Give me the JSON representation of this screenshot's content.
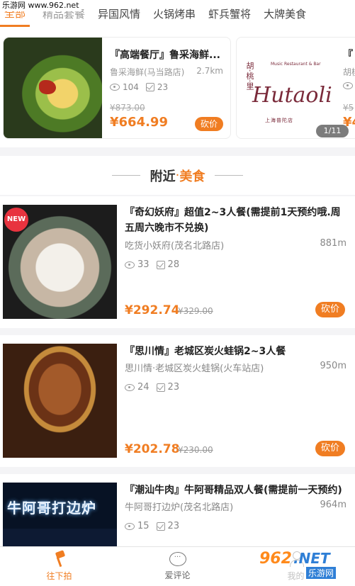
{
  "watermark_top": "乐游网 www.962.net",
  "tabs": [
    "全部",
    "精品套餐",
    "异国风情",
    "火锅烤串",
    "虾兵蟹将",
    "大牌美食"
  ],
  "carousel": {
    "pager": "1/11",
    "cards": [
      {
        "title": "『高端餐厅』鲁采海鲜...",
        "shop": "鲁采海鲜(马当路店)",
        "distance": "2.7km",
        "views": "104",
        "checks": "23",
        "old_price": "¥873.00",
        "price": "¥664.99",
        "bargain": "砍价"
      },
      {
        "title": "『",
        "shop": "胡桃",
        "logo_cn": "胡·桃·里",
        "logo_en": "Hutaoli",
        "logo_small": "Music Restaurant & Bar",
        "logo_addr": "上海普陀店",
        "views": "",
        "checks": "",
        "old_price": "¥5",
        "price": "¥4"
      }
    ]
  },
  "section": {
    "left": "附近",
    "dot": "·",
    "right": "美食"
  },
  "items": [
    {
      "title": "『奇幻妖府』超值2~3人餐(需提前1天预约哦.周五周六晚市不兑换)",
      "shop": "吃货小妖府(茂名北路店)",
      "distance": "881m",
      "views": "33",
      "checks": "28",
      "price": "¥292.74",
      "old_price": "¥329.00",
      "bargain": "砍价",
      "badge": "NEW"
    },
    {
      "title": "『思川情』老城区炭火蛙锅2~3人餐",
      "shop": "思川情·老城区炭火蛙锅(火车站店)",
      "distance": "950m",
      "views": "24",
      "checks": "23",
      "price": "¥202.78",
      "old_price": "¥230.00",
      "bargain": "砍价"
    },
    {
      "title": "『潮汕牛肉』牛阿哥精品双人餐(需提前一天预约)",
      "shop": "牛阿哥打边炉(茂名北路店)",
      "distance": "964m",
      "views": "15",
      "checks": "23",
      "neon_sign": "牛阿哥打边炉"
    }
  ],
  "bottom_nav": [
    {
      "label": "往下拍",
      "icon": "hammer-icon"
    },
    {
      "label": "爱评论",
      "icon": "comment-bubble-icon"
    },
    {
      "label": "我的",
      "icon": "person-icon"
    }
  ],
  "watermark_bottom": {
    "num": "962",
    "net": ".NET",
    "sub": "乐游网"
  },
  "colors": {
    "accent": "#f07d22",
    "bg": "#f4f4f6"
  }
}
